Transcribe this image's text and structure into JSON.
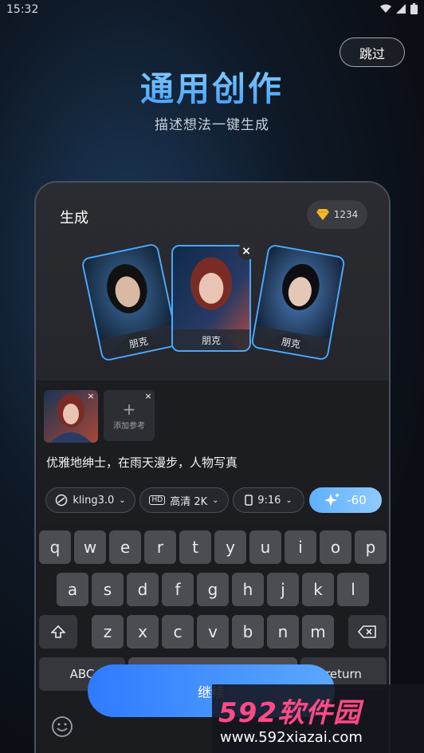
{
  "status": {
    "time": "15:32"
  },
  "skip_label": "跳过",
  "hero": {
    "title": "通用创作",
    "subtitle": "描述想法一键生成"
  },
  "generator": {
    "title": "生成",
    "credits": "1234",
    "cards": [
      {
        "label": "朋克"
      },
      {
        "label": "朋克"
      },
      {
        "label": "朋克"
      }
    ]
  },
  "reference": {
    "add_label": "添加参考"
  },
  "prompt_text": "优雅地绅士，在雨天漫步，人物写真",
  "options": {
    "model": "kling3.0",
    "quality_badge": "HD",
    "quality": "高清 2K",
    "ratio": "9:16",
    "cost": "-60"
  },
  "keyboard": {
    "row1": [
      "q",
      "w",
      "e",
      "r",
      "t",
      "y",
      "u",
      "i",
      "o",
      "p"
    ],
    "row2": [
      "a",
      "s",
      "d",
      "f",
      "g",
      "h",
      "j",
      "k",
      "l"
    ],
    "row3": [
      "z",
      "x",
      "c",
      "v",
      "b",
      "n",
      "m"
    ],
    "abc": "ABC",
    "return": "return"
  },
  "continue_label": "继续",
  "watermark": {
    "brand": "592软件园",
    "url": "www.592xiazai.com"
  }
}
